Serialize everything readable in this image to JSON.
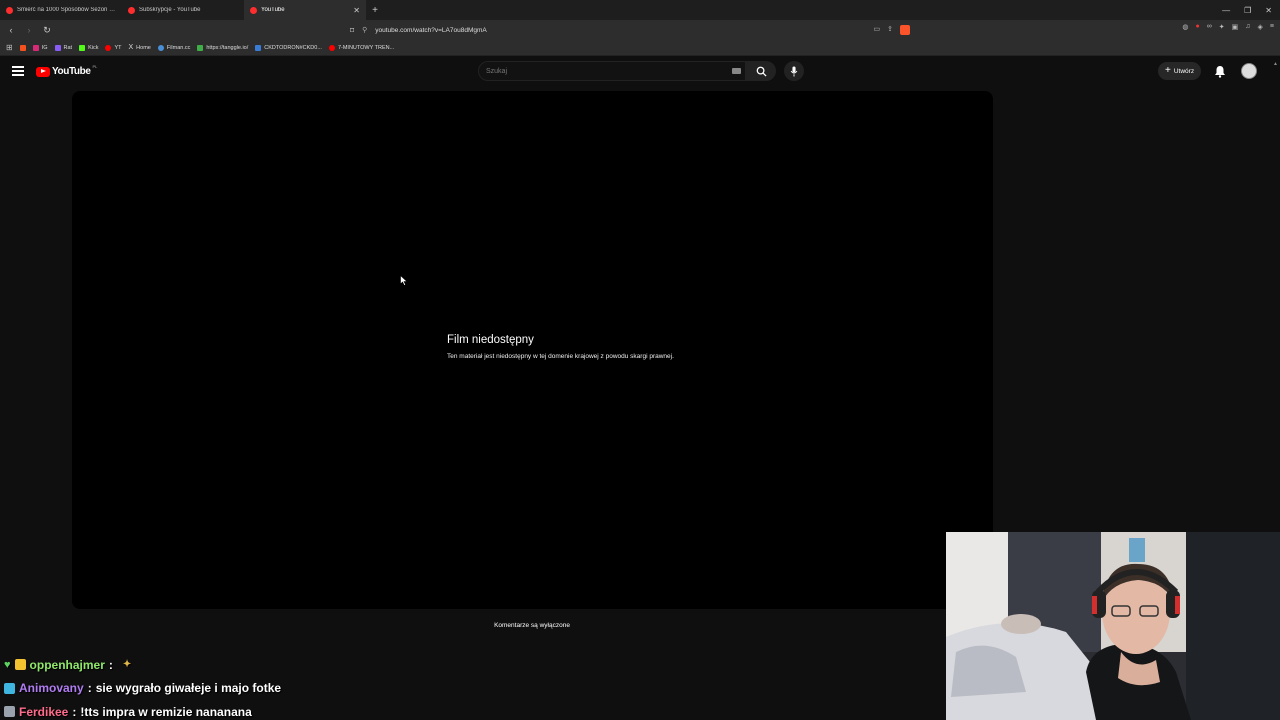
{
  "browser": {
    "tabs": [
      {
        "title": "Śmierć na 1000 Sposobów Sezon 2 O",
        "active": false
      },
      {
        "title": "Subskrypcje - YouTube",
        "active": false
      },
      {
        "title": "YouTube",
        "active": true
      }
    ],
    "url": "youtube.com/watch?v=LA7ou8dMgmA",
    "bookmarks": [
      "IG",
      "Rat",
      "Kick",
      "YT",
      "Home",
      "Filman.cc",
      "https://tanggle.io/",
      "CKDTODRON#CKD0...",
      "7-MINUTOWY TREN..."
    ],
    "colors": {
      "tab_bar": "#1e1e1e",
      "toolbar": "#2d2d2d",
      "accent": "#ff0000"
    }
  },
  "youtube": {
    "logo_text": "YouTube",
    "country_code": "PL",
    "search_placeholder": "Szukaj",
    "create_label": "Utwórz",
    "player": {
      "title": "Film niedostępny",
      "message": "Ten materiał jest niedostępny w tej domenie krajowej z powodu skargi prawnej."
    },
    "comments_off": "Komentarze są wyłączone"
  },
  "chat": [
    {
      "user": "oppenhajmer",
      "message": ""
    },
    {
      "user": "Animovany",
      "message": "sie wygrało giwałeje i majo fotke"
    },
    {
      "user": "Ferdikee",
      "message": "!tts impra w remizie nananana"
    }
  ],
  "icons": [
    "menu-icon",
    "search-icon",
    "mic-icon",
    "bell-icon",
    "keyboard-icon",
    "plus-icon"
  ]
}
